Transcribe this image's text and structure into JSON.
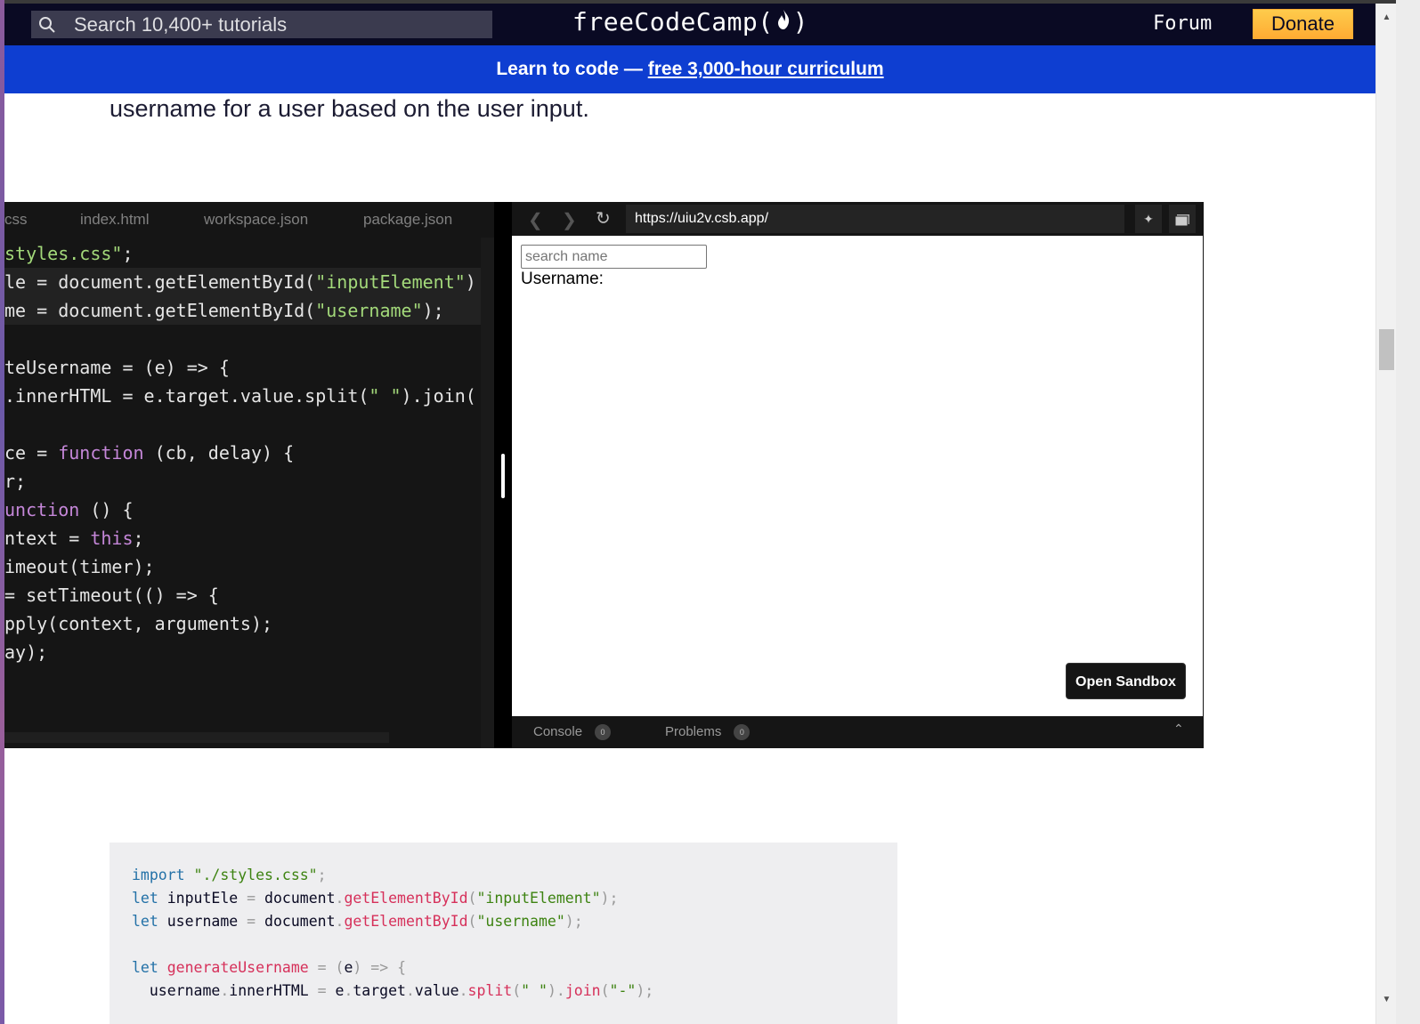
{
  "navbar": {
    "search_placeholder": "Search 10,400+ tutorials",
    "brand_left": "freeCodeCamp(",
    "brand_right": ")",
    "forum_label": "Forum",
    "donate_label": "Donate"
  },
  "banner": {
    "prefix": "Learn to code — ",
    "link_text": "free 3,000-hour curriculum"
  },
  "article": {
    "intro_text": "username for a user based on the user input."
  },
  "editor": {
    "tabs": [
      "css",
      "index.html",
      "workspace.json",
      "package.json"
    ],
    "lines": [
      [
        {
          "t": "styles.css\"",
          "c": "str"
        },
        {
          "t": ";",
          "c": ""
        }
      ],
      [
        {
          "t": "le = document.getElementById(",
          "c": ""
        },
        {
          "t": "\"inputElement\"",
          "c": "str"
        },
        {
          "t": ")",
          "c": ""
        }
      ],
      [
        {
          "t": "me = document.getElementById(",
          "c": ""
        },
        {
          "t": "\"username\"",
          "c": "str"
        },
        {
          "t": ");",
          "c": ""
        }
      ],
      [],
      [
        {
          "t": "teUsername = (e) => {",
          "c": ""
        }
      ],
      [
        {
          "t": ".innerHTML = e.target.value.split(",
          "c": ""
        },
        {
          "t": "\" \"",
          "c": "str"
        },
        {
          "t": ").join(",
          "c": ""
        }
      ],
      [],
      [
        {
          "t": "ce = ",
          "c": ""
        },
        {
          "t": "function",
          "c": "kw"
        },
        {
          "t": " (cb, delay) {",
          "c": ""
        }
      ],
      [
        {
          "t": "r;",
          "c": ""
        }
      ],
      [
        {
          "t": "unction",
          "c": "kw"
        },
        {
          "t": " () {",
          "c": ""
        }
      ],
      [
        {
          "t": "ntext = ",
          "c": ""
        },
        {
          "t": "this",
          "c": "kw"
        },
        {
          "t": ";",
          "c": ""
        }
      ],
      [
        {
          "t": "imeout(timer);",
          "c": ""
        }
      ],
      [
        {
          "t": "= setTimeout(() => {",
          "c": ""
        }
      ],
      [
        {
          "t": "pply(context, arguments);",
          "c": ""
        }
      ],
      [
        {
          "t": "ay);",
          "c": ""
        }
      ]
    ]
  },
  "preview": {
    "url": "https://uiu2v.csb.app/",
    "input_placeholder": "search name",
    "username_label": "Username:",
    "open_sandbox_label": "Open Sandbox",
    "console_label": "Console",
    "console_count": "0",
    "problems_label": "Problems",
    "problems_count": "0"
  },
  "code_block": {
    "lines": [
      [
        {
          "t": "import",
          "c": "kw"
        },
        {
          "t": " ",
          "c": ""
        },
        {
          "t": "\"./styles.css\"",
          "c": "str"
        },
        {
          "t": ";",
          "c": "op"
        }
      ],
      [
        {
          "t": "let",
          "c": "kw"
        },
        {
          "t": " inputEle ",
          "c": ""
        },
        {
          "t": "=",
          "c": "op"
        },
        {
          "t": " document",
          "c": ""
        },
        {
          "t": ".",
          "c": "op"
        },
        {
          "t": "getElementById",
          "c": "fn"
        },
        {
          "t": "(",
          "c": "op"
        },
        {
          "t": "\"inputElement\"",
          "c": "str"
        },
        {
          "t": ");",
          "c": "op"
        }
      ],
      [
        {
          "t": "let",
          "c": "kw"
        },
        {
          "t": " username ",
          "c": ""
        },
        {
          "t": "=",
          "c": "op"
        },
        {
          "t": " document",
          "c": ""
        },
        {
          "t": ".",
          "c": "op"
        },
        {
          "t": "getElementById",
          "c": "fn"
        },
        {
          "t": "(",
          "c": "op"
        },
        {
          "t": "\"username\"",
          "c": "str"
        },
        {
          "t": ");",
          "c": "op"
        }
      ],
      [],
      [
        {
          "t": "let",
          "c": "kw"
        },
        {
          "t": " ",
          "c": ""
        },
        {
          "t": "generateUsername",
          "c": "fn"
        },
        {
          "t": " ",
          "c": ""
        },
        {
          "t": "=",
          "c": "op"
        },
        {
          "t": " ",
          "c": ""
        },
        {
          "t": "(",
          "c": "op"
        },
        {
          "t": "e",
          "c": ""
        },
        {
          "t": ")",
          "c": "op"
        },
        {
          "t": " ",
          "c": ""
        },
        {
          "t": "=>",
          "c": "op"
        },
        {
          "t": " ",
          "c": ""
        },
        {
          "t": "{",
          "c": "op"
        }
      ],
      [
        {
          "t": "  username",
          "c": ""
        },
        {
          "t": ".",
          "c": "op"
        },
        {
          "t": "innerHTML ",
          "c": ""
        },
        {
          "t": "=",
          "c": "op"
        },
        {
          "t": " e",
          "c": ""
        },
        {
          "t": ".",
          "c": "op"
        },
        {
          "t": "target",
          "c": ""
        },
        {
          "t": ".",
          "c": "op"
        },
        {
          "t": "value",
          "c": ""
        },
        {
          "t": ".",
          "c": "op"
        },
        {
          "t": "split",
          "c": "fn"
        },
        {
          "t": "(",
          "c": "op"
        },
        {
          "t": "\" \"",
          "c": "str"
        },
        {
          "t": ").",
          "c": "op"
        },
        {
          "t": "join",
          "c": "fn"
        },
        {
          "t": "(",
          "c": "op"
        },
        {
          "t": "\"-\"",
          "c": "str"
        },
        {
          "t": ");",
          "c": "op"
        }
      ]
    ]
  },
  "colors": {
    "navbar_bg": "#0a0a23",
    "banner_bg": "#0e3ed1",
    "donate_bg": "#ffbf00",
    "editor_bg": "#151515"
  }
}
